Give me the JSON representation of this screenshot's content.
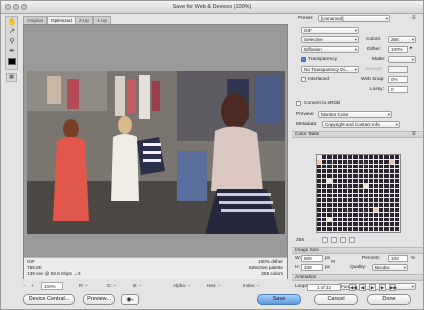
{
  "window": {
    "title": "Save for Web & Devices (100%)"
  },
  "tabs": [
    "Original",
    "Optimized",
    "2-Up",
    "4-Up"
  ],
  "preview_info": {
    "left_lines": [
      "GIF",
      "765.8K",
      "139 sec @ 56.6 Kbps  →≡"
    ],
    "right_lines": [
      "100% dither",
      "Selective palette",
      "256 colors"
    ]
  },
  "statusbar": {
    "zoom": "100%",
    "r_label": "R: --",
    "g_label": "G: --",
    "b_label": "B: --",
    "alpha_label": "Alpha: --",
    "hex_label": "Hex: --",
    "index_label": "Index: --"
  },
  "footer": {
    "device_central": "Device Central...",
    "preview": "Preview...",
    "save": "Save",
    "cancel": "Cancel",
    "done": "Done"
  },
  "settings": {
    "preset_label": "Preset:",
    "preset_value": "[Unnamed]",
    "format": "GIF",
    "reduction": "Selective",
    "colors_label": "Colors:",
    "colors_value": "256",
    "dither_algo": "Diffusion",
    "dither_label": "Dither:",
    "dither_value": "100%",
    "transparency_label": "Transparency",
    "transparency_checked": true,
    "matte_label": "Matte:",
    "matte_value": "",
    "trans_dither": "No Transparency Di...",
    "amount_label": "Amount:",
    "interlaced_label": "Interlaced",
    "interlaced_checked": false,
    "websnap_label": "Web Snap:",
    "websnap_value": "0%",
    "lossy_label": "Lossy:",
    "lossy_value": "0"
  },
  "convert_srgb": {
    "label": "Convert to sRGB",
    "checked": false
  },
  "preview_select": {
    "label": "Preview:",
    "value": "Monitor Color"
  },
  "metadata": {
    "label": "Metadata:",
    "value": "Copyright and Contact Info"
  },
  "color_table": {
    "title": "Color Table",
    "count": "256"
  },
  "image_size": {
    "title": "Image Size",
    "w_label": "W:",
    "w_value": "600",
    "h_label": "H:",
    "h_value": "338",
    "px": "px",
    "percent_label": "Percent:",
    "percent_value": "100",
    "pct_unit": "%",
    "quality_label": "Quality:",
    "quality_value": "Bicubic"
  },
  "animation": {
    "title": "Animation",
    "looping_label": "Looping Options:",
    "looping_value": "Forever",
    "frame": "1 of 32"
  },
  "colors": {
    "accent": "#5a9ae0",
    "panel": "#e4e4e4",
    "preview_bg": "#9a9a9a"
  },
  "icons": [
    "hand-icon",
    "slice-select-icon",
    "zoom-icon",
    "eyedropper-icon",
    "eyedropper-color-swatch",
    "toggle-slices-icon",
    "panel-menu-icon",
    "link-chain-icon",
    "first-frame-icon",
    "prev-frame-icon",
    "play-icon",
    "next-frame-icon",
    "last-frame-icon"
  ]
}
